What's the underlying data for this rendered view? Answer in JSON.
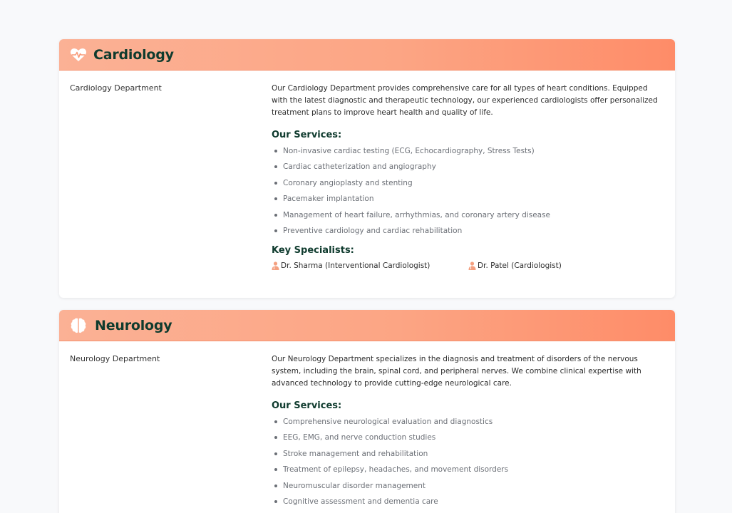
{
  "colors": {
    "header_start": "#fbb195",
    "header_end": "#fe8c68",
    "title_text": "#0f3b2e",
    "accent_icon": "#f4a080",
    "page_background": "#f8f9fb"
  },
  "departments": [
    {
      "title": "Cardiology",
      "icon": "heart-pulse-icon",
      "image_alt": "Cardiology Department",
      "description": "Our Cardiology Department provides comprehensive care for all types of heart conditions. Equipped with the latest diagnostic and therapeutic technology, our experienced cardiologists offer personalized treatment plans to improve heart health and quality of life.",
      "services_heading": "Our Services:",
      "services": [
        "Non-invasive cardiac testing (ECG, Echocardiography, Stress Tests)",
        "Cardiac catheterization and angiography",
        "Coronary angioplasty and stenting",
        "Pacemaker implantation",
        "Management of heart failure, arrhythmias, and coronary artery disease",
        "Preventive cardiology and cardiac rehabilitation"
      ],
      "specialists_heading": "Key Specialists:",
      "specialists": [
        "Dr. Sharma (Interventional Cardiologist)",
        "Dr. Patel (Cardiologist)"
      ]
    },
    {
      "title": "Neurology",
      "icon": "brain-icon",
      "image_alt": "Neurology Department",
      "description": "Our Neurology Department specializes in the diagnosis and treatment of disorders of the nervous system, including the brain, spinal cord, and peripheral nerves. We combine clinical expertise with advanced technology to provide cutting-edge neurological care.",
      "services_heading": "Our Services:",
      "services": [
        "Comprehensive neurological evaluation and diagnostics",
        "EEG, EMG, and nerve conduction studies",
        "Stroke management and rehabilitation",
        "Treatment of epilepsy, headaches, and movement disorders",
        "Neuromuscular disorder management",
        "Cognitive assessment and dementia care"
      ]
    }
  ]
}
